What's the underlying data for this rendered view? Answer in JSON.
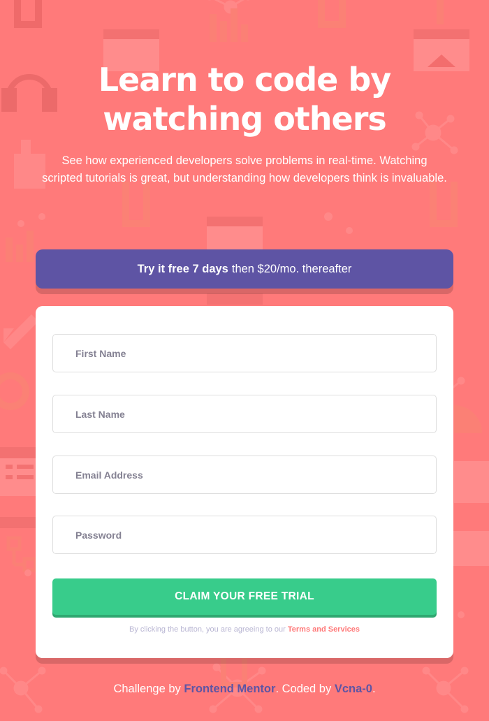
{
  "hero": {
    "title": "Learn to code by watching others",
    "text": "See how experienced developers solve problems in real-time. Watching scripted tutorials is great, but understanding how developers think is invaluable."
  },
  "promo": {
    "highlight": "Try it free 7 days",
    "rest": "then $20/mo. thereafter"
  },
  "form": {
    "first_name_placeholder": "First Name",
    "last_name_placeholder": "Last Name",
    "email_placeholder": "Email Address",
    "password_placeholder": "Password",
    "submit_label": "CLAIM YOUR FREE TRIAL",
    "terms_prefix": "By clicking the button, you are agreeing to our",
    "terms_link": "Terms and Services"
  },
  "footer": {
    "prefix": "Challenge by",
    "mentor_link": "Frontend Mentor",
    "middle": ". Coded by",
    "author_link": "Vcna-0",
    "suffix": "."
  },
  "colors": {
    "background": "#ff7a7a",
    "banner": "#5e54a4",
    "button": "#38cc8b",
    "card": "#ffffff",
    "link": "#5e54a4",
    "terms_link": "#ff7a7a"
  },
  "icons": [
    "brackets-icon",
    "bar-chart-icon",
    "browser-window-icon",
    "headset-icon",
    "network-nodes-icon",
    "mug-icon",
    "thumbs-up-icon",
    "rocket-icon",
    "gear-globe-icon",
    "calendar-icon",
    "flowchart-icon",
    "document-icon",
    "pie-chart-icon"
  ]
}
